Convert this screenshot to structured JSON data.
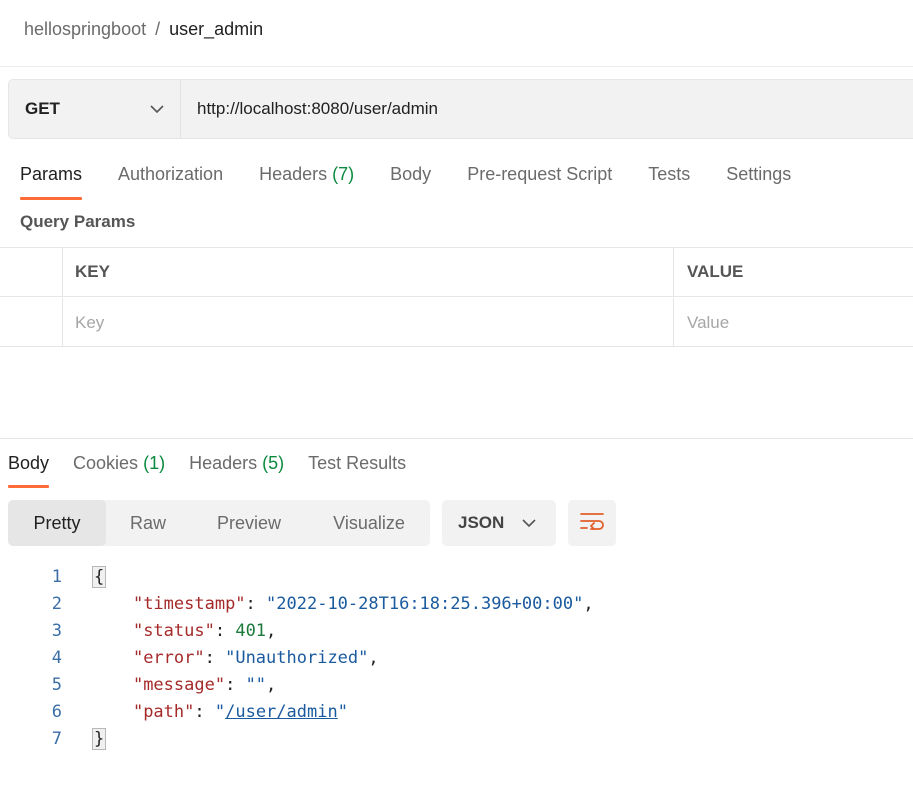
{
  "breadcrumb": {
    "parent": "hellospringboot",
    "separator": "/",
    "current": "user_admin"
  },
  "request": {
    "method": "GET",
    "url": "http://localhost:8080/user/admin"
  },
  "request_tabs": [
    {
      "label": "Params",
      "count": "",
      "active": true
    },
    {
      "label": "Authorization",
      "count": "",
      "active": false
    },
    {
      "label": "Headers",
      "count": "(7)",
      "active": false
    },
    {
      "label": "Body",
      "count": "",
      "active": false
    },
    {
      "label": "Pre-request Script",
      "count": "",
      "active": false
    },
    {
      "label": "Tests",
      "count": "",
      "active": false
    },
    {
      "label": "Settings",
      "count": "",
      "active": false
    }
  ],
  "query_params": {
    "title": "Query Params",
    "col_key": "KEY",
    "col_value": "VALUE",
    "key_placeholder": "Key",
    "value_placeholder": "Value"
  },
  "response_tabs": [
    {
      "label": "Body",
      "count": "",
      "active": true
    },
    {
      "label": "Cookies",
      "count": "(1)",
      "active": false
    },
    {
      "label": "Headers",
      "count": "(5)",
      "active": false
    },
    {
      "label": "Test Results",
      "count": "",
      "active": false
    }
  ],
  "format_modes": [
    "Pretty",
    "Raw",
    "Preview",
    "Visualize"
  ],
  "active_format": "Pretty",
  "language": "JSON",
  "code": {
    "line_numbers": [
      "1",
      "2",
      "3",
      "4",
      "5",
      "6",
      "7"
    ],
    "open_brace": "{",
    "close_brace": "}",
    "entries": [
      {
        "key": "\"timestamp\"",
        "value": "\"2022-10-28T16:18:25.396+00:00\"",
        "kind": "string"
      },
      {
        "key": "\"status\"",
        "value": "401",
        "kind": "number"
      },
      {
        "key": "\"error\"",
        "value": "\"Unauthorized\"",
        "kind": "string"
      },
      {
        "key": "\"message\"",
        "value": "\"\"",
        "kind": "string"
      },
      {
        "key": "\"path\"",
        "value": "\"/user/admin\"",
        "kind": "link",
        "link_text": "/user/admin"
      }
    ]
  },
  "colors": {
    "accent": "#ff6c37",
    "count_green": "#1b7a3a",
    "json_key": "#a52a2a",
    "json_string": "#1a5a9e",
    "json_number": "#1b7a3a",
    "line_number": "#3a6ea5"
  },
  "icons": {
    "method_dropdown": "chevron-down-icon",
    "language_dropdown": "chevron-down-icon",
    "wrap": "wrap-lines-icon"
  }
}
